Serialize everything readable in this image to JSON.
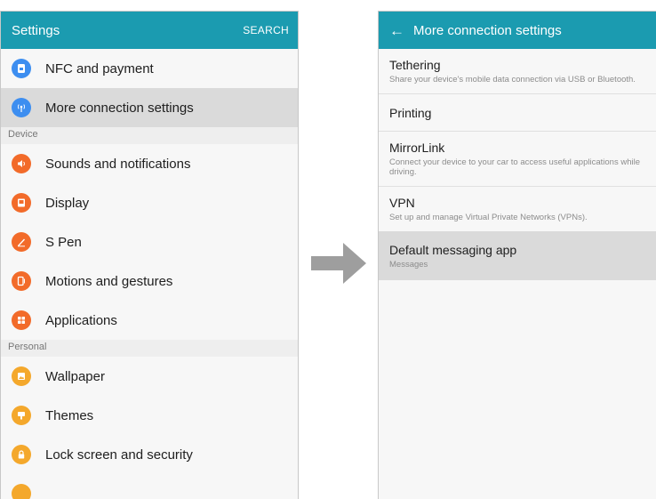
{
  "left": {
    "title": "Settings",
    "action": "SEARCH",
    "items_top": [
      {
        "label": "NFC and payment",
        "icon": "nfc-icon",
        "color": "#3d8ef0"
      },
      {
        "label": "More connection settings",
        "icon": "wireless-icon",
        "color": "#3d8ef0"
      }
    ],
    "sections": {
      "device": "Device",
      "personal": "Personal"
    },
    "device_items": [
      {
        "label": "Sounds and notifications",
        "icon": "volume-icon",
        "color": "#f26b2a"
      },
      {
        "label": "Display",
        "icon": "display-icon",
        "color": "#f26b2a"
      },
      {
        "label": "S Pen",
        "icon": "pen-icon",
        "color": "#f26b2a"
      },
      {
        "label": "Motions and gestures",
        "icon": "motion-icon",
        "color": "#f26b2a"
      },
      {
        "label": "Applications",
        "icon": "apps-icon",
        "color": "#f26b2a"
      }
    ],
    "personal_items": [
      {
        "label": "Wallpaper",
        "icon": "wallpaper-icon",
        "color": "#f4a82c"
      },
      {
        "label": "Themes",
        "icon": "themes-icon",
        "color": "#f4a82c"
      },
      {
        "label": "Lock screen and security",
        "icon": "lock-icon",
        "color": "#f4a82c"
      }
    ]
  },
  "right": {
    "title": "More connection settings",
    "items": [
      {
        "title": "Tethering",
        "sub": "Share your device's mobile data connection via USB or Bluetooth."
      },
      {
        "title": "Printing",
        "sub": ""
      },
      {
        "title": "MirrorLink",
        "sub": "Connect your device to your car to access useful applications while driving."
      },
      {
        "title": "VPN",
        "sub": "Set up and manage Virtual Private Networks (VPNs)."
      },
      {
        "title": "Default messaging app",
        "sub": "Messages"
      }
    ]
  },
  "colors": {
    "appbar": "#1b9bb0",
    "arrow": "#9e9e9e"
  }
}
